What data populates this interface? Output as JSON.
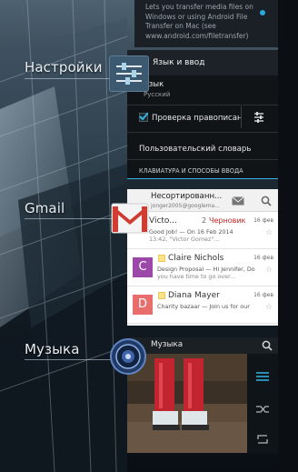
{
  "labels": {
    "settings": "Настройки",
    "gmail": "Gmail",
    "music": "Музыка"
  },
  "top_card": {
    "lines": [
      "Lets you transfer media files on",
      "Windows or using Android File",
      "Transfer on Mac (see",
      "www.android.com/filetransfer)"
    ]
  },
  "settings": {
    "header": "Язык и ввод",
    "lang_title": "Язык",
    "lang_value": "Русский",
    "spellcheck": "Проверка правописан",
    "user_dictionary": "Пользовательский словарь",
    "section_keyboard": "КЛАВИАТУРА И СПОСОБЫ ВВОДА"
  },
  "gmail": {
    "header_title": "Несортированн...",
    "header_account": "jonger2005@googlema...",
    "messages": [
      {
        "initial": "",
        "name": "Victo...",
        "count": "2",
        "draft": "Черновик",
        "date": "16 фев",
        "subject": "Good Job! — On 16 Feb 2014",
        "preview": "13:42, \"Victor Gomez\"..."
      },
      {
        "initial": "C",
        "name": "Claire Nichols",
        "count": "",
        "draft": "",
        "date": "16 фев",
        "subject": "Design Proposal — Hi Jennifer, Do",
        "preview": "you have time to go over..."
      },
      {
        "initial": "D",
        "name": "Diana Mayer",
        "count": "",
        "draft": "",
        "date": "16 фев",
        "subject": "Charity bazaar — Join us for our",
        "preview": ""
      }
    ]
  },
  "music": {
    "title": "Музыка"
  },
  "colors": {
    "accent": "#33b5e5",
    "avatar_c": "#9c48a8",
    "avatar_d": "#e86d6d",
    "gmail_red": "#d03b32",
    "draft_red": "#cc2222"
  }
}
